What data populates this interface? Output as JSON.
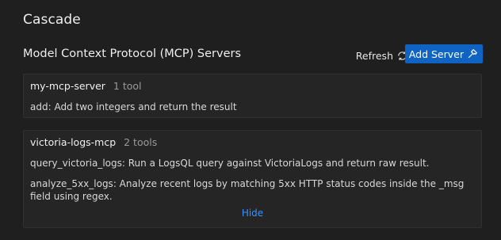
{
  "app": {
    "title": "Cascade"
  },
  "mcp": {
    "section_title": "Model Context Protocol (MCP) Servers",
    "refresh_label": "Refresh",
    "add_server_label": "Add Server",
    "servers": [
      {
        "name": "my-mcp-server",
        "tool_count": "1 tool",
        "tools": [
          "add: Add two integers and return the result"
        ]
      },
      {
        "name": "victoria-logs-mcp",
        "tool_count": "2 tools",
        "tools": [
          "query_victoria_logs: Run a LogsQL query against VictoriaLogs and return raw result.",
          "analyze_5xx_logs: Analyze recent logs by matching 5xx HTTP status codes inside the _msg field using regex."
        ],
        "hide_label": "Hide"
      }
    ]
  },
  "icons": {
    "refresh": "refresh-icon",
    "add_server": "hammer-icon"
  },
  "colors": {
    "background": "#1f1f1f",
    "card": "#252526",
    "accent": "#0e63c3",
    "link": "#3794ff"
  }
}
